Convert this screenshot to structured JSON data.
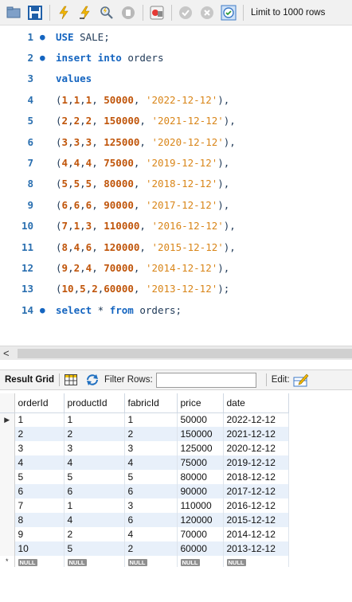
{
  "toolbar": {
    "buttons": [
      {
        "name": "open-folder-icon"
      },
      {
        "name": "save-icon"
      },
      {
        "name": "execute-lightning-icon"
      },
      {
        "name": "execute-cursor-lightning-icon"
      },
      {
        "name": "explain-magnifier-icon"
      },
      {
        "name": "stop-icon"
      },
      {
        "name": "toggle-error-continue-icon"
      },
      {
        "name": "commit-icon"
      },
      {
        "name": "rollback-icon"
      },
      {
        "name": "autocommit-icon"
      }
    ],
    "limit_label": "Limit to 1000 rows"
  },
  "editor": {
    "lines": [
      {
        "n": "1",
        "dot": true,
        "tokens": [
          [
            "kw",
            "USE"
          ],
          [
            "pn",
            " SALE;"
          ]
        ]
      },
      {
        "n": "2",
        "dot": true,
        "tokens": [
          [
            "kw",
            "insert into"
          ],
          [
            "idn",
            " orders"
          ]
        ]
      },
      {
        "n": "3",
        "dot": false,
        "tokens": [
          [
            "kw",
            "values"
          ]
        ]
      },
      {
        "n": "4",
        "dot": false,
        "tokens": [
          [
            "pn",
            "("
          ],
          [
            "num",
            "1"
          ],
          [
            "pn",
            ","
          ],
          [
            "num",
            "1"
          ],
          [
            "pn",
            ","
          ],
          [
            "num",
            "1"
          ],
          [
            "pn",
            ", "
          ],
          [
            "num",
            "50000"
          ],
          [
            "pn",
            ", "
          ],
          [
            "str",
            "'2022-12-12'"
          ],
          [
            "pn",
            "),"
          ]
        ]
      },
      {
        "n": "5",
        "dot": false,
        "tokens": [
          [
            "pn",
            "("
          ],
          [
            "num",
            "2"
          ],
          [
            "pn",
            ","
          ],
          [
            "num",
            "2"
          ],
          [
            "pn",
            ","
          ],
          [
            "num",
            "2"
          ],
          [
            "pn",
            ", "
          ],
          [
            "num",
            "150000"
          ],
          [
            "pn",
            ", "
          ],
          [
            "str",
            "'2021-12-12'"
          ],
          [
            "pn",
            "),"
          ]
        ]
      },
      {
        "n": "6",
        "dot": false,
        "tokens": [
          [
            "pn",
            "("
          ],
          [
            "num",
            "3"
          ],
          [
            "pn",
            ","
          ],
          [
            "num",
            "3"
          ],
          [
            "pn",
            ","
          ],
          [
            "num",
            "3"
          ],
          [
            "pn",
            ", "
          ],
          [
            "num",
            "125000"
          ],
          [
            "pn",
            ", "
          ],
          [
            "str",
            "'2020-12-12'"
          ],
          [
            "pn",
            "),"
          ]
        ]
      },
      {
        "n": "7",
        "dot": false,
        "tokens": [
          [
            "pn",
            "("
          ],
          [
            "num",
            "4"
          ],
          [
            "pn",
            ","
          ],
          [
            "num",
            "4"
          ],
          [
            "pn",
            ","
          ],
          [
            "num",
            "4"
          ],
          [
            "pn",
            ", "
          ],
          [
            "num",
            "75000"
          ],
          [
            "pn",
            ", "
          ],
          [
            "str",
            "'2019-12-12'"
          ],
          [
            "pn",
            "),"
          ]
        ]
      },
      {
        "n": "8",
        "dot": false,
        "tokens": [
          [
            "pn",
            "("
          ],
          [
            "num",
            "5"
          ],
          [
            "pn",
            ","
          ],
          [
            "num",
            "5"
          ],
          [
            "pn",
            ","
          ],
          [
            "num",
            "5"
          ],
          [
            "pn",
            ", "
          ],
          [
            "num",
            "80000"
          ],
          [
            "pn",
            ", "
          ],
          [
            "str",
            "'2018-12-12'"
          ],
          [
            "pn",
            "),"
          ]
        ]
      },
      {
        "n": "9",
        "dot": false,
        "tokens": [
          [
            "pn",
            "("
          ],
          [
            "num",
            "6"
          ],
          [
            "pn",
            ","
          ],
          [
            "num",
            "6"
          ],
          [
            "pn",
            ","
          ],
          [
            "num",
            "6"
          ],
          [
            "pn",
            ", "
          ],
          [
            "num",
            "90000"
          ],
          [
            "pn",
            ", "
          ],
          [
            "str",
            "'2017-12-12'"
          ],
          [
            "pn",
            "),"
          ]
        ]
      },
      {
        "n": "10",
        "dot": false,
        "tokens": [
          [
            "pn",
            "("
          ],
          [
            "num",
            "7"
          ],
          [
            "pn",
            ","
          ],
          [
            "num",
            "1"
          ],
          [
            "pn",
            ","
          ],
          [
            "num",
            "3"
          ],
          [
            "pn",
            ", "
          ],
          [
            "num",
            "110000"
          ],
          [
            "pn",
            ", "
          ],
          [
            "str",
            "'2016-12-12'"
          ],
          [
            "pn",
            "),"
          ]
        ]
      },
      {
        "n": "11",
        "dot": false,
        "tokens": [
          [
            "pn",
            "("
          ],
          [
            "num",
            "8"
          ],
          [
            "pn",
            ","
          ],
          [
            "num",
            "4"
          ],
          [
            "pn",
            ","
          ],
          [
            "num",
            "6"
          ],
          [
            "pn",
            ", "
          ],
          [
            "num",
            "120000"
          ],
          [
            "pn",
            ", "
          ],
          [
            "str",
            "'2015-12-12'"
          ],
          [
            "pn",
            "),"
          ]
        ]
      },
      {
        "n": "12",
        "dot": false,
        "tokens": [
          [
            "pn",
            "("
          ],
          [
            "num",
            "9"
          ],
          [
            "pn",
            ","
          ],
          [
            "num",
            "2"
          ],
          [
            "pn",
            ","
          ],
          [
            "num",
            "4"
          ],
          [
            "pn",
            ", "
          ],
          [
            "num",
            "70000"
          ],
          [
            "pn",
            ", "
          ],
          [
            "str",
            "'2014-12-12'"
          ],
          [
            "pn",
            "),"
          ]
        ]
      },
      {
        "n": "13",
        "dot": false,
        "tokens": [
          [
            "pn",
            "("
          ],
          [
            "num",
            "10"
          ],
          [
            "pn",
            ","
          ],
          [
            "num",
            "5"
          ],
          [
            "pn",
            ","
          ],
          [
            "num",
            "2"
          ],
          [
            "pn",
            ","
          ],
          [
            "num",
            "60000"
          ],
          [
            "pn",
            ", "
          ],
          [
            "str",
            "'2013-12-12'"
          ],
          [
            "pn",
            ");"
          ]
        ]
      },
      {
        "n": "14",
        "dot": true,
        "tokens": [
          [
            "kw",
            "select"
          ],
          [
            "pn",
            " * "
          ],
          [
            "kw",
            "from"
          ],
          [
            "idn",
            " orders;"
          ]
        ]
      }
    ]
  },
  "scrollbar": {
    "left_arrow": "<"
  },
  "result_bar": {
    "result_grid_label": "Result Grid",
    "filter_label": "Filter Rows:",
    "filter_value": "",
    "edit_label": "Edit:"
  },
  "grid": {
    "columns": [
      "orderId",
      "productId",
      "fabricId",
      "price",
      "date"
    ],
    "rows": [
      [
        "1",
        "1",
        "1",
        "50000",
        "2022-12-12"
      ],
      [
        "2",
        "2",
        "2",
        "150000",
        "2021-12-12"
      ],
      [
        "3",
        "3",
        "3",
        "125000",
        "2020-12-12"
      ],
      [
        "4",
        "4",
        "4",
        "75000",
        "2019-12-12"
      ],
      [
        "5",
        "5",
        "5",
        "80000",
        "2018-12-12"
      ],
      [
        "6",
        "6",
        "6",
        "90000",
        "2017-12-12"
      ],
      [
        "7",
        "1",
        "3",
        "110000",
        "2016-12-12"
      ],
      [
        "8",
        "4",
        "6",
        "120000",
        "2015-12-12"
      ],
      [
        "9",
        "2",
        "4",
        "70000",
        "2014-12-12"
      ],
      [
        "10",
        "5",
        "2",
        "60000",
        "2013-12-12"
      ]
    ],
    "null_label": "NULL",
    "current_row_marker": "▶",
    "new_row_marker": "*"
  },
  "colors": {
    "keyword": "#1565c0",
    "number": "#c0550a",
    "string": "#d9861a",
    "line_number": "#2a6fb0",
    "row_alt": "#e8f0fa"
  }
}
